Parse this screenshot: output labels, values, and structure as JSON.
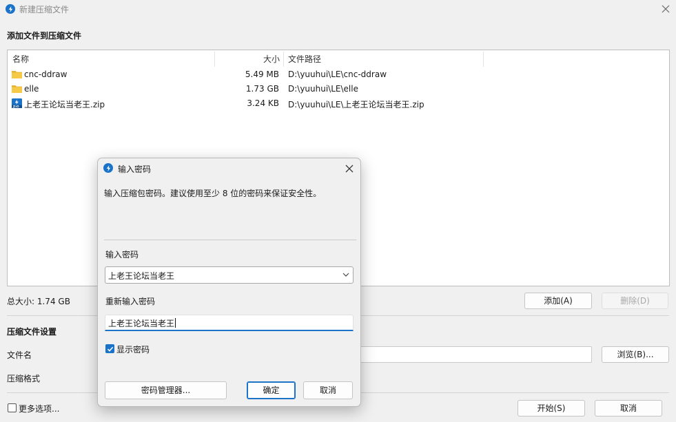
{
  "window": {
    "title": "新建压缩文件"
  },
  "files_section": {
    "heading": "添加文件到压缩文件",
    "columns": {
      "name": "名称",
      "size": "大小",
      "path": "文件路径"
    },
    "rows": [
      {
        "name": "cnc-ddraw",
        "size": "5.49 MB",
        "path": "D:\\yuuhui\\LE\\cnc-ddraw",
        "icon": "folder-icon"
      },
      {
        "name": "elle",
        "size": "1.73 GB",
        "path": "D:\\yuuhui\\LE\\elle",
        "icon": "folder-icon"
      },
      {
        "name": "上老王论坛当老王.zip",
        "size": "3.24 KB",
        "path": "D:\\yuuhui\\LE\\上老王论坛当老王.zip",
        "icon": "zip-file-icon"
      }
    ],
    "total_size": "总大小: 1.74 GB",
    "add_button": "添加(A)",
    "delete_button": "删除(D)"
  },
  "settings_section": {
    "heading": "压缩文件设置",
    "filename_label": "文件名",
    "format_label": "压缩格式",
    "browse_button": "浏览(B)..."
  },
  "footer": {
    "more_options": "更多选项...",
    "more_options_checked": false,
    "start_button": "开始(S)",
    "cancel_button": "取消"
  },
  "password_dialog": {
    "title": "输入密码",
    "description": "输入压缩包密码。建议使用至少 8 位的密码来保证安全性。",
    "password_label": "输入密码",
    "password_value": "上老王论坛当老王",
    "confirm_label": "重新输入密码",
    "confirm_value": "上老王论坛当老王",
    "show_password_label": "显示密码",
    "show_password_checked": true,
    "manager_button": "密码管理器...",
    "ok_button": "确定",
    "cancel_button": "取消"
  },
  "colors": {
    "accent": "#1a73c8",
    "folder": "#f5c542"
  }
}
